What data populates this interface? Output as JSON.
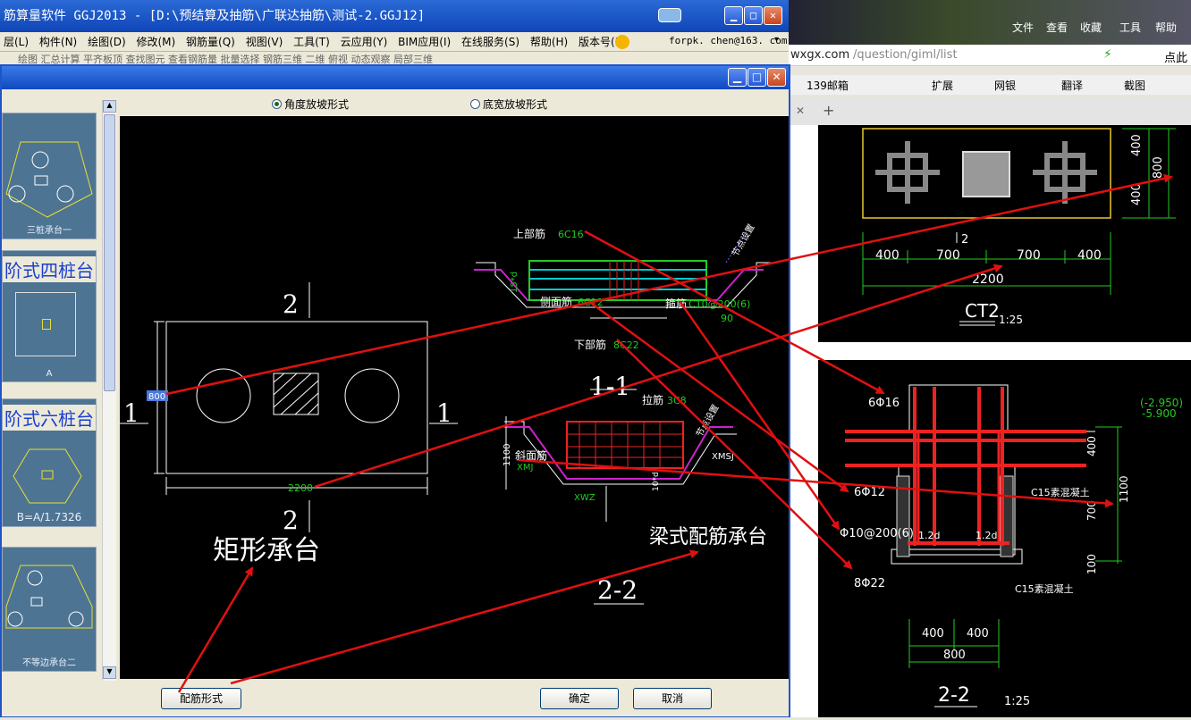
{
  "app": {
    "title": "筋算量软件 GGJ2013 - [D:\\预结算及抽筋\\广联达抽筋\\测试-2.GGJ12]",
    "menu": [
      "层(L)",
      "构件(N)",
      "绘图(D)",
      "修改(M)",
      "钢筋量(Q)",
      "视图(V)",
      "工具(T)",
      "云应用(Y)",
      "BIM应用(I)",
      "在线服务(S)",
      "帮助(H)",
      "版本号(B)"
    ],
    "user": "forpk. chen@163. com",
    "toolbar_text": "绘图  汇总计算   平齐板顶   查找图元   查看钢筋量   批量选择   钢筋三维    二维    俯视    动态观察    局部三维"
  },
  "browser": {
    "links": [
      "文件",
      "查看",
      "收藏",
      "工具",
      "帮助"
    ],
    "url_host": "wxgx.com",
    "url_path": "/question/giml/list",
    "search_hint": "点此",
    "bookmarks": [
      "139邮箱",
      "扩展",
      "网银",
      "翻译",
      "截图"
    ]
  },
  "dialog": {
    "radio_angle": "角度放坡形式",
    "radio_width": "底宽放坡形式",
    "thumbs": [
      {
        "title": "",
        "label": "三桩承台一"
      },
      {
        "title": "阶式四桩台",
        "label": "A"
      },
      {
        "title": "阶式六桩台",
        "label": "B=A/1.7326"
      },
      {
        "title": "",
        "label": "不等边承台二"
      }
    ],
    "buttons": {
      "rebar_form": "配筋形式",
      "ok": "确定",
      "cancel": "取消"
    },
    "cad": {
      "rect_label": "矩形承台",
      "beam_label": "梁式配筋承台",
      "section_11": "1-1",
      "section_22": "2-2",
      "dim_2200": "2200",
      "dim_800": "800",
      "num_1": "1",
      "num_2": "2",
      "top_bar": "上部筋",
      "top_bar_val": "6C16",
      "side_bar": "侧面筋",
      "side_bar_val": "6C12",
      "stirrup": "箍筋",
      "stirrup_val": "C10@200(6)",
      "bottom_bar": "下部筋",
      "bottom_bar_val": "8C22",
      "tie_bar": "拉筋",
      "tie_bar_val": "3C8",
      "slope_bar": "斜面筋",
      "slope_bar_val": "XMJ",
      "xwz": "XWZ",
      "xmsj": "XMSJ",
      "node": "节点设置",
      "ninety": "90",
      "left_dim": "1100",
      "gauge": "15*d",
      "gauge2": "10*d"
    }
  },
  "right": {
    "ct2": "CT2",
    "scale1": "1:25",
    "dims_top": [
      "400",
      "700",
      "700",
      "400"
    ],
    "total": "2200",
    "dim_400": "400",
    "dim_800": "800",
    "mark_2": "2",
    "sec22": "2-2",
    "scale2": "1:25",
    "bar_6c16": "6Φ16",
    "bar_6c12": "6Φ12",
    "bar_stirrup": "Φ10@200(6)",
    "bar_8c22": "8Φ22",
    "elev1": "(-2.950)",
    "elev2": "-5.900",
    "c15a": "C15素混凝土",
    "c15b": "C15素混凝土",
    "dims_right": [
      "400",
      "1100",
      "700",
      "100"
    ],
    "bottom_dims": [
      "400",
      "400",
      "800"
    ],
    "ld": "1.2d"
  }
}
